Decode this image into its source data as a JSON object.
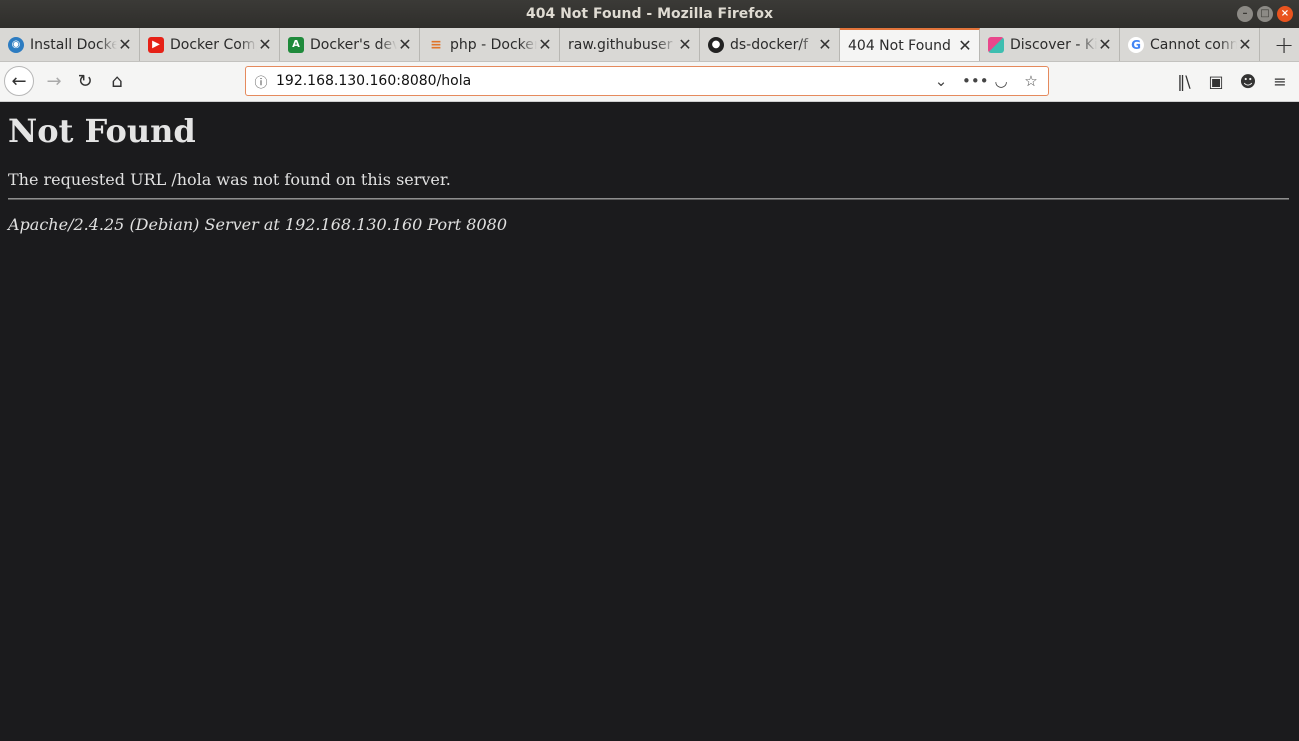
{
  "window": {
    "title": "404 Not Found - Mozilla Firefox"
  },
  "tabs": [
    {
      "label": "Install Docker",
      "icon": "docker-docs-icon",
      "color": "#2d7cc1",
      "active": false
    },
    {
      "label": "Docker Compose",
      "icon": "youtube-icon",
      "color": "#e62117",
      "active": false
    },
    {
      "label": "Docker's dev",
      "icon": "android-icon",
      "color": "#1f8a3b",
      "active": false
    },
    {
      "label": "php - Docker",
      "icon": "stackoverflow-icon",
      "color": "#e0742a",
      "active": false
    },
    {
      "label": "raw.githubuser",
      "icon": "",
      "color": "",
      "active": false
    },
    {
      "label": "ds-docker/f",
      "icon": "github-icon",
      "color": "#222222",
      "active": false
    },
    {
      "label": "404 Not Found",
      "icon": "",
      "color": "",
      "active": true
    },
    {
      "label": "Discover - Ki",
      "icon": "kibana-icon",
      "color": "#e8478b",
      "active": false
    },
    {
      "label": "Cannot conn",
      "icon": "google-icon",
      "color": "#4285f4",
      "active": false
    }
  ],
  "navbar": {
    "url": "192.168.130.160:8080/hola"
  },
  "page": {
    "heading": "Not Found",
    "message": "The requested URL /hola was not found on this server.",
    "server_signature": "Apache/2.4.25 (Debian) Server at 192.168.130.160 Port 8080"
  }
}
